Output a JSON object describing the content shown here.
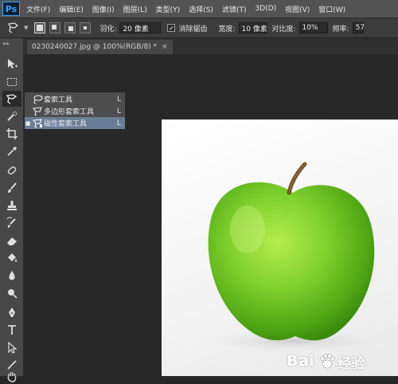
{
  "menubar": {
    "logo": "Ps",
    "items": [
      "文件(F)",
      "编辑(E)",
      "图像(I)",
      "图层(L)",
      "类型(Y)",
      "选择(S)",
      "滤镜(T)",
      "3D(D)",
      "视图(V)",
      "窗口(W)"
    ]
  },
  "options": {
    "feather_label": "羽化:",
    "feather_value": "20 像素",
    "antialias_label": "消除锯齿",
    "antialias_checked": true,
    "width_label": "宽度:",
    "width_value": "10 像素",
    "contrast_label": "对比度:",
    "contrast_value": "10%",
    "frequency_label": "频率:",
    "frequency_value": "57"
  },
  "document_tab": {
    "title": "0230240027.jpg @ 100%(RGB/8) *",
    "close": "×"
  },
  "flyout": {
    "items": [
      {
        "label": "套索工具",
        "shortcut": "L",
        "selected": false,
        "icon": "lasso-icon"
      },
      {
        "label": "多边形套索工具",
        "shortcut": "L",
        "selected": false,
        "icon": "polygonal-lasso-icon"
      },
      {
        "label": "磁性套索工具",
        "shortcut": "L",
        "selected": true,
        "icon": "magnetic-lasso-icon"
      }
    ]
  },
  "toolbar": {
    "tools": [
      "move-icon",
      "marquee-icon",
      "lasso-icon",
      "quick-selection-icon",
      "crop-icon",
      "eyedropper-icon",
      "healing-brush-icon",
      "brush-icon",
      "clone-stamp-icon",
      "history-brush-icon",
      "eraser-icon",
      "paint-bucket-icon",
      "blur-icon",
      "dodge-icon",
      "pen-icon",
      "type-icon",
      "path-selection-icon",
      "line-icon",
      "hand-icon"
    ]
  },
  "colors": {
    "selection_highlight": "#6a7d97",
    "apple_green": "#6cc21d",
    "ps_blue": "#31a8ff"
  },
  "watermark": {
    "text": "Bai",
    "text2": "经验"
  }
}
